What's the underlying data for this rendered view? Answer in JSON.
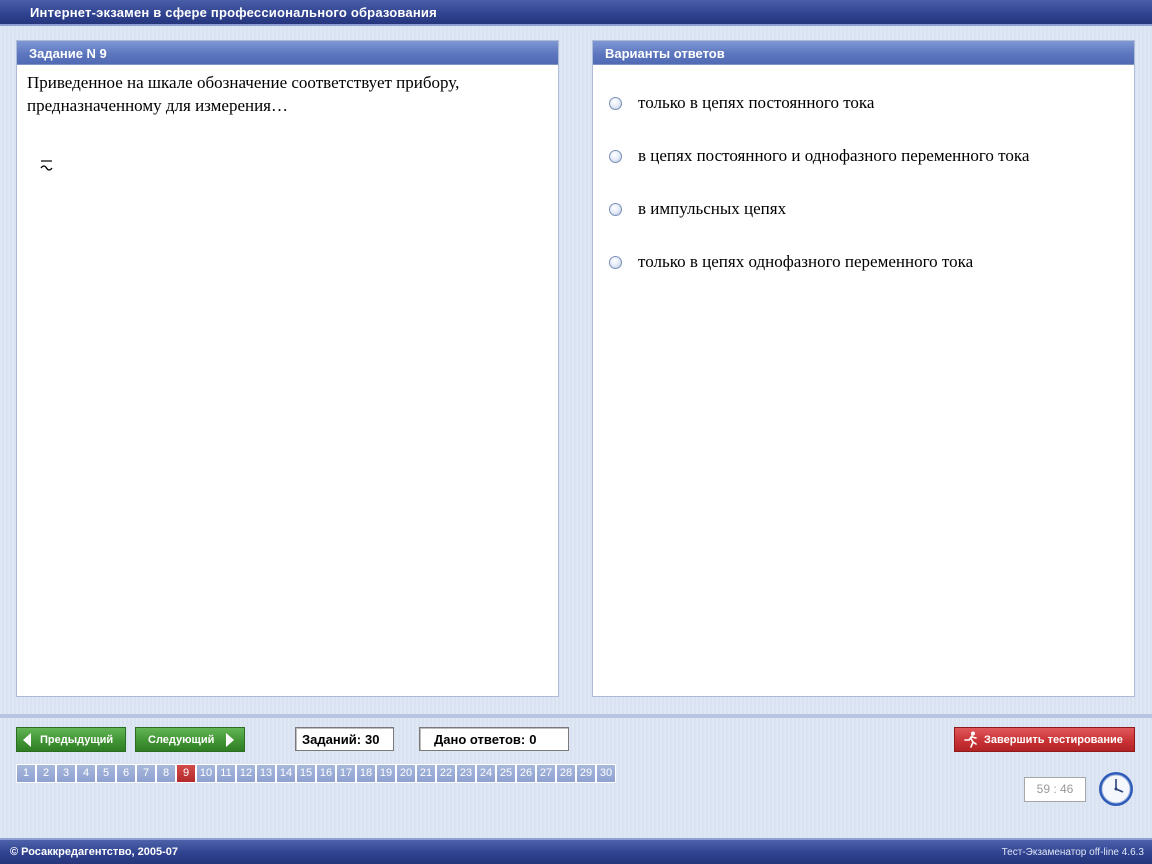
{
  "window": {
    "title": "Интернет-экзамен в сфере профессионального образования"
  },
  "question": {
    "header": "Задание N 9",
    "text": "Приведенное на шкале обозначение соответствует прибору, предназначенному для измерения…",
    "symbol": "~"
  },
  "answers": {
    "header": "Варианты ответов",
    "options": [
      {
        "label": "только в цепях постоянного тока",
        "selected": false
      },
      {
        "label": "в цепях постоянного и  однофазного переменного тока",
        "selected": false
      },
      {
        "label": "в импульсных цепях",
        "selected": false
      },
      {
        "label": "только в цепях однофазного переменного тока",
        "selected": false
      }
    ]
  },
  "nav": {
    "prev_label": "Предыдущий",
    "next_label": "Следующий",
    "tasks_label": "Заданий:",
    "tasks_count": "30",
    "answered_label": "Дано ответов:",
    "answered_count": "0",
    "finish_label": "Завершить тестирование",
    "current_task": 9,
    "task_numbers": [
      "1",
      "2",
      "3",
      "4",
      "5",
      "6",
      "7",
      "8",
      "9",
      "10",
      "11",
      "12",
      "13",
      "14",
      "15",
      "16",
      "17",
      "18",
      "19",
      "20",
      "21",
      "22",
      "23",
      "24",
      "25",
      "26",
      "27",
      "28",
      "29",
      "30"
    ]
  },
  "timer": {
    "value": "59 : 46"
  },
  "footer": {
    "copyright": "© Росаккредагентство, 2005-07",
    "version": "Тест-Экзаменатор off-line 4.6.3"
  },
  "colors": {
    "title_bar": "#2f4290",
    "panel_header": "#5d77bf",
    "button_green": "#3f9232",
    "button_red": "#c73134",
    "current_task": "#b22a2a"
  },
  "icons": {
    "finish": "running-person-icon",
    "clock": "clock-icon",
    "prev": "arrow-left-icon",
    "next": "arrow-right-icon"
  }
}
